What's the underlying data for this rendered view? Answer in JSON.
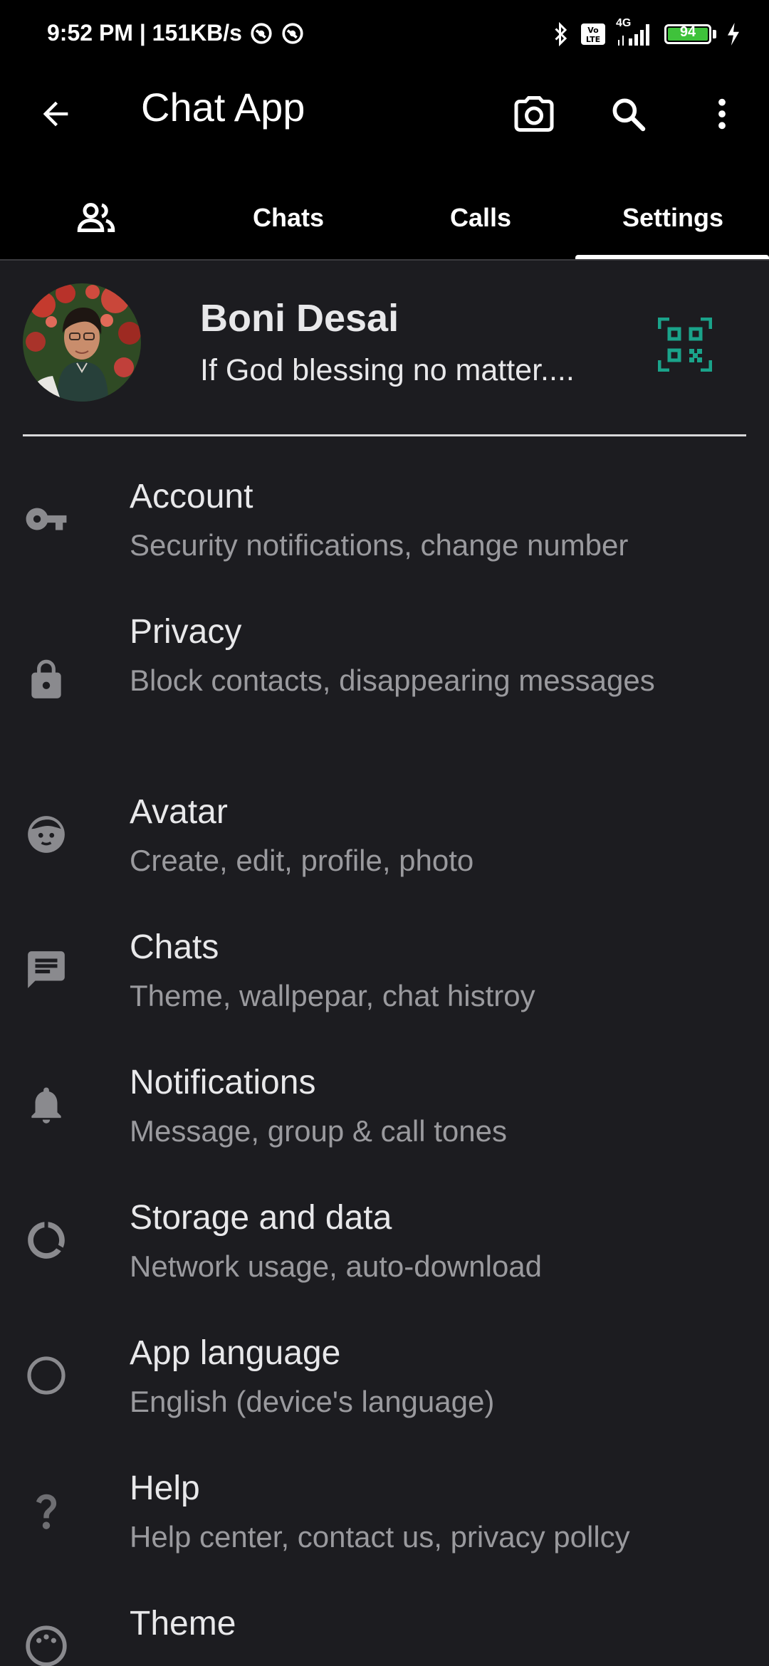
{
  "status_bar": {
    "time_speed": "9:52 PM | 151KB/s",
    "network_label": "4G",
    "battery_level": "94"
  },
  "app_bar": {
    "title": "Chat App"
  },
  "tabs": [
    {
      "label": ""
    },
    {
      "label": "Chats"
    },
    {
      "label": "Calls"
    },
    {
      "label": "Settings",
      "selected": true
    }
  ],
  "profile": {
    "name": "Boni Desai",
    "status": "If God blessing no matter...."
  },
  "menu": [
    {
      "icon": "key-icon",
      "title": "Account",
      "subtitle": "Security notifications, change number"
    },
    {
      "icon": "lock-icon",
      "title": "Privacy",
      "subtitle": "Block contacts, disappearing messages"
    },
    {
      "icon": "avatar-face-icon",
      "title": "Avatar",
      "subtitle": "Create, edit, profile, photo"
    },
    {
      "icon": "chat-icon",
      "title": "Chats",
      "subtitle": "Theme, wallpepar, chat histroy"
    },
    {
      "icon": "bell-icon",
      "title": "Notifications",
      "subtitle": "Message, group & call tones"
    },
    {
      "icon": "storage-icon",
      "title": "Storage and data",
      "subtitle": "Network usage, auto-download"
    },
    {
      "icon": "globe-icon",
      "title": "App language",
      "subtitle": "English (device's language)"
    },
    {
      "icon": "help-icon",
      "title": "Help",
      "subtitle": "Help center, contact us, privacy pollcy"
    },
    {
      "icon": "theme-icon",
      "title": "Theme",
      "subtitle": ""
    }
  ],
  "colors": {
    "background": "#1c1c20",
    "app_bar": "#000000",
    "accent_qr": "#1aa38a",
    "secondary_text": "#9a9a9e"
  }
}
